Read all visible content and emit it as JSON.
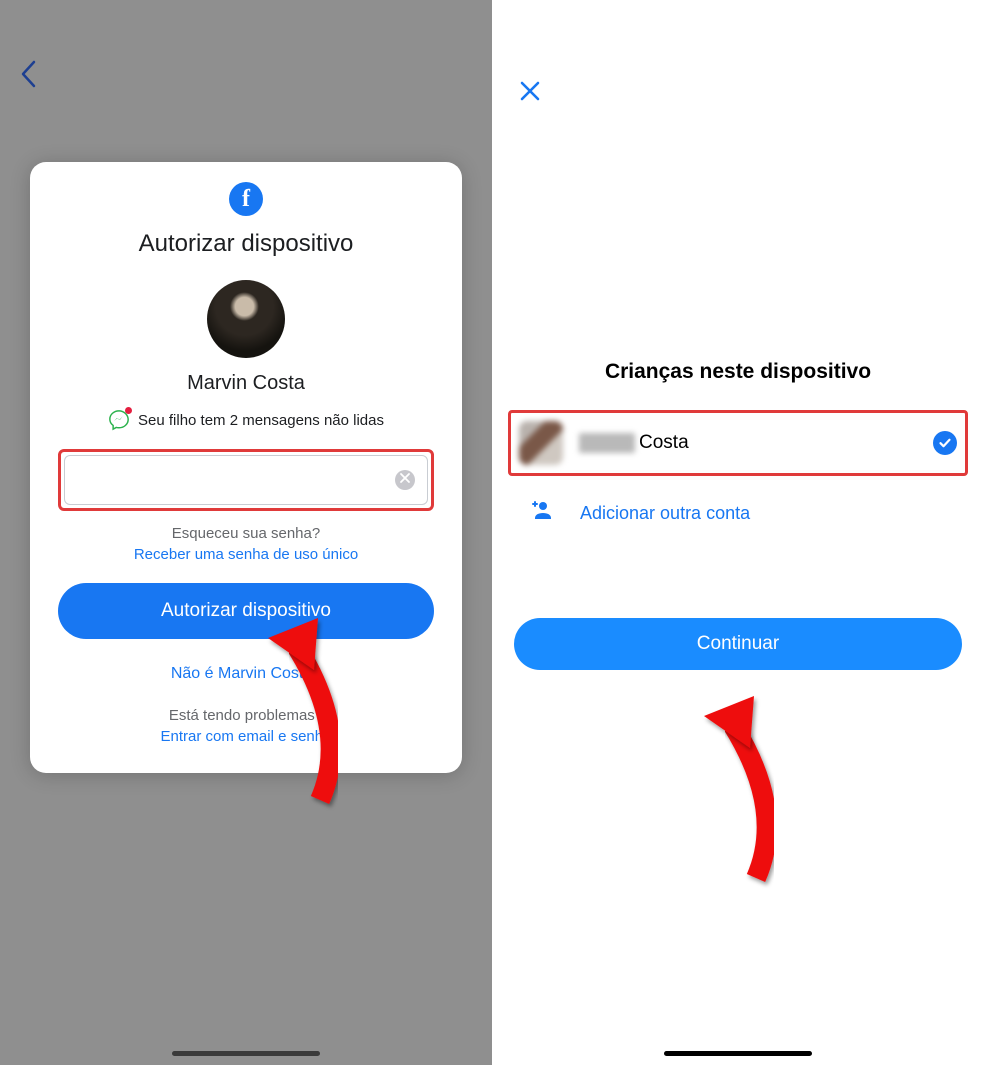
{
  "left": {
    "title": "Autorizar dispositivo",
    "user_name": "Marvin Costa",
    "messages_notice": "Seu filho tem 2 mensagens não lidas",
    "forgot_question": "Esqueceu sua senha?",
    "forgot_link": "Receber uma senha de uso único",
    "authorize_button": "Autorizar dispositivo",
    "not_user": "Não é Marvin Costa?",
    "problems_question": "Está tendo problemas?",
    "problems_link": "Entrar com email e senha"
  },
  "right": {
    "title": "Crianças neste dispositivo",
    "child_lastname": "Costa",
    "add_account": "Adicionar outra conta",
    "continue_button": "Continuar"
  }
}
